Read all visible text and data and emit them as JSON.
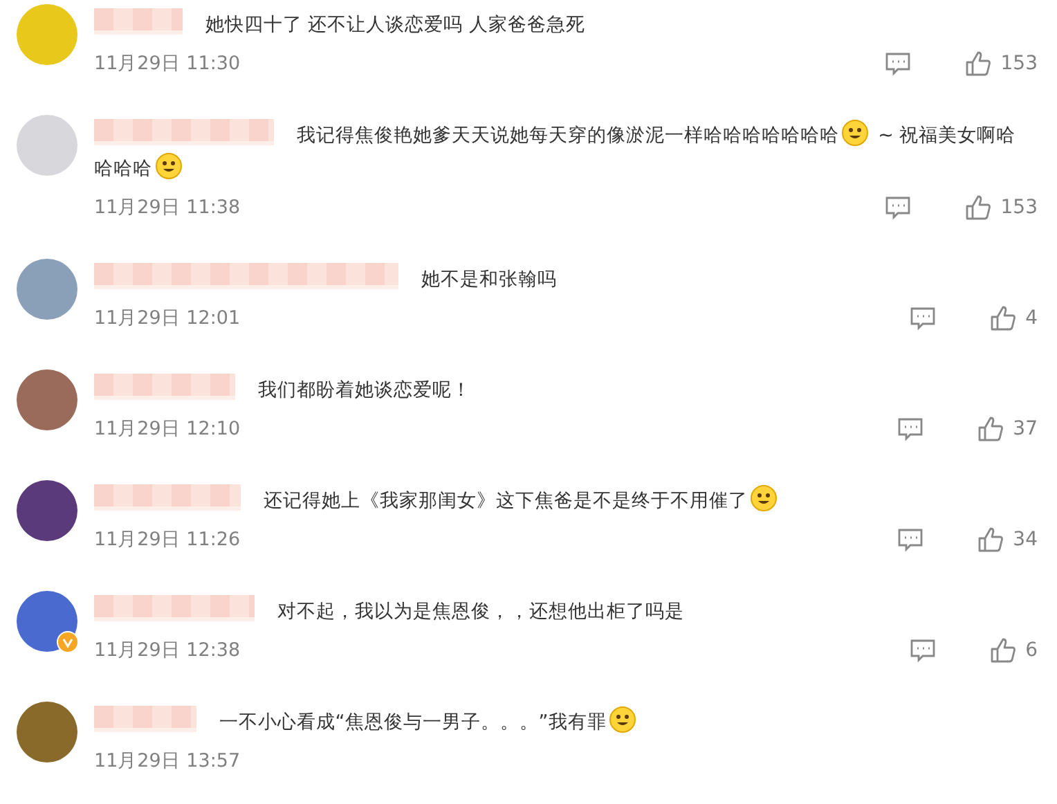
{
  "comments": [
    {
      "verified": false,
      "content": [
        {
          "kind": "text",
          "text": "她快四十了 还不让人谈恋爱吗 人家爸爸急死"
        }
      ],
      "time": "11月29日 11:30",
      "likes": "153"
    },
    {
      "verified": false,
      "content": [
        {
          "kind": "text",
          "text": "我记得焦俊艳她爹天天说她每天穿的像淤泥一样哈哈哈哈哈哈哈"
        },
        {
          "kind": "emoji"
        },
        {
          "kind": "text",
          "text": "~ 祝福美女啊哈"
        },
        {
          "kind": "text",
          "text": "哈哈哈"
        },
        {
          "kind": "emoji"
        }
      ],
      "time": "11月29日 11:38",
      "likes": "153"
    },
    {
      "verified": false,
      "content": [
        {
          "kind": "text",
          "text": "她不是和张翰吗"
        }
      ],
      "time": "11月29日 12:01",
      "likes": "4"
    },
    {
      "verified": false,
      "content": [
        {
          "kind": "text",
          "text": "我们都盼着她谈恋爱呢！"
        }
      ],
      "time": "11月29日 12:10",
      "likes": "37"
    },
    {
      "verified": false,
      "content": [
        {
          "kind": "text",
          "text": "还记得她上《我家那闺女》这下焦爸是不是终于不用催了"
        },
        {
          "kind": "emoji"
        }
      ],
      "time": "11月29日 11:26",
      "likes": "34"
    },
    {
      "verified": true,
      "content": [
        {
          "kind": "text",
          "text": "对不起，我以为是焦恩俊，，还想他出柜了吗是"
        }
      ],
      "time": "11月29日 12:38",
      "likes": "6"
    },
    {
      "verified": false,
      "content": [
        {
          "kind": "text",
          "text": "一不小心看成“焦恩俊与一男子。。。”我有罪"
        },
        {
          "kind": "emoji"
        }
      ],
      "time": "11月29日 13:57"
    }
  ]
}
